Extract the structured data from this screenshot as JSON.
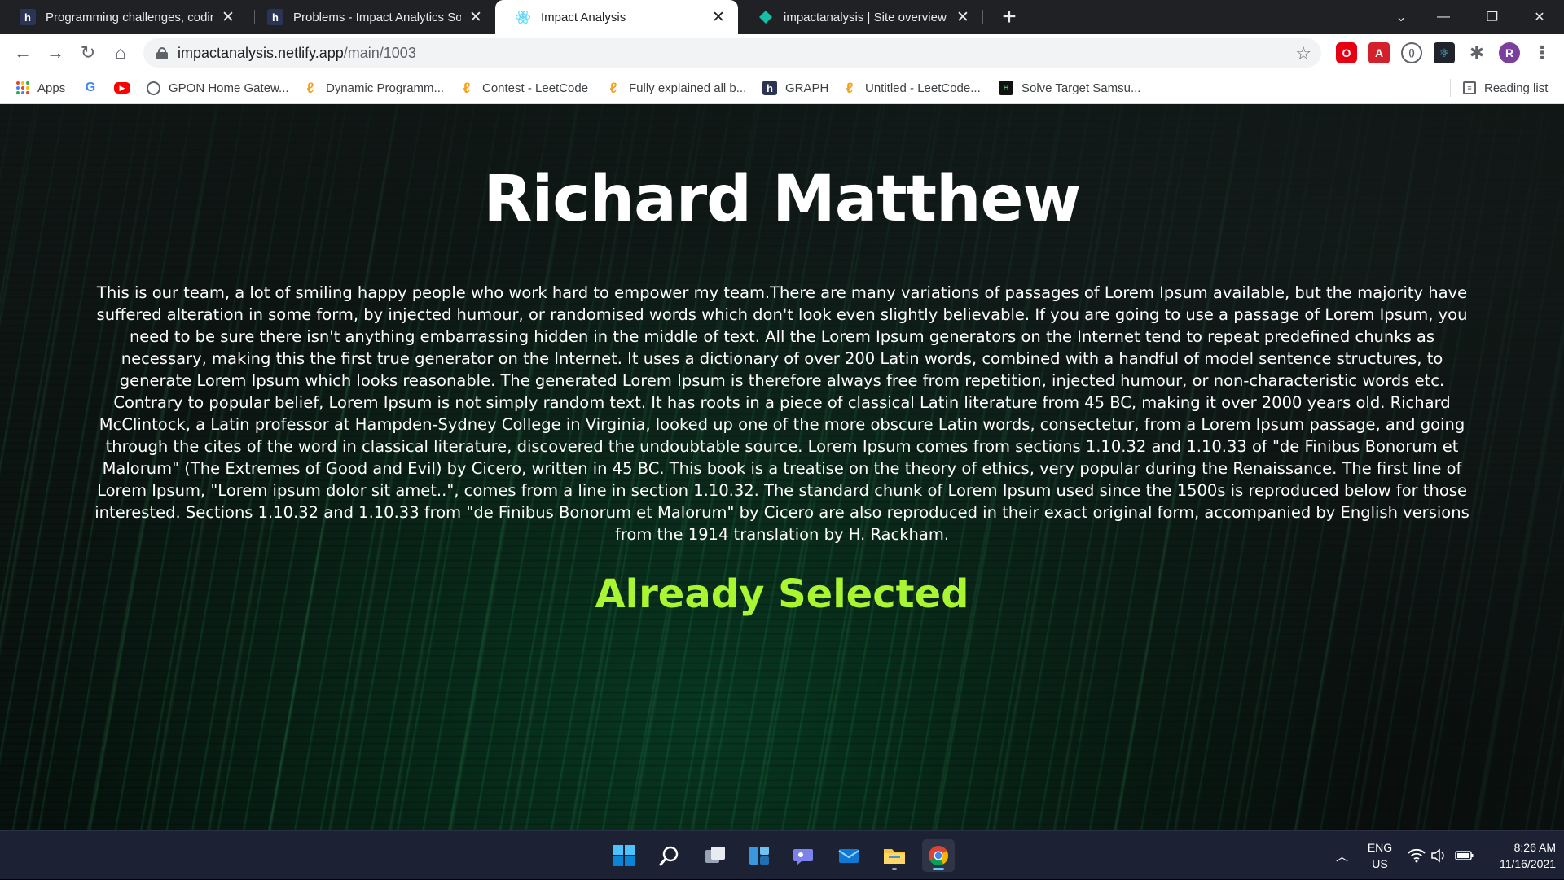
{
  "browser": {
    "tabs": [
      {
        "title": "Programming challenges, coding",
        "favicon": "hackerearth-icon",
        "active": false
      },
      {
        "title": "Problems - Impact Analytics Soft",
        "favicon": "hackerearth-icon",
        "active": false
      },
      {
        "title": "Impact Analysis",
        "favicon": "react-icon",
        "active": true
      },
      {
        "title": "impactanalysis | Site overview",
        "favicon": "netlify-icon",
        "active": false
      }
    ],
    "url_host": "impactanalysis.netlify.app",
    "url_path": "/main/1003",
    "bookmarks": [
      {
        "label": "Apps",
        "icon": "apps-grid-icon"
      },
      {
        "label": "",
        "icon": "google-icon"
      },
      {
        "label": "",
        "icon": "youtube-icon"
      },
      {
        "label": "GPON Home Gatew...",
        "icon": "globe-icon"
      },
      {
        "label": "Dynamic Programm...",
        "icon": "leetcode-icon"
      },
      {
        "label": "Contest - LeetCode",
        "icon": "leetcode-icon"
      },
      {
        "label": "Fully explained all b...",
        "icon": "leetcode-icon"
      },
      {
        "label": "GRAPH",
        "icon": "hackerearth-icon"
      },
      {
        "label": "Untitled - LeetCode...",
        "icon": "leetcode-icon"
      },
      {
        "label": "Solve Target Samsu...",
        "icon": "hackerearth-icon"
      }
    ],
    "reading_list_label": "Reading list"
  },
  "page": {
    "name": "Richard Matthew",
    "bio": "This is our team, a lot of smiling happy people who work hard to empower my team.There are many variations of passages of Lorem Ipsum available, but the majority have suffered alteration in some form, by injected humour, or randomised words which don't look even slightly believable. If you are going to use a passage of Lorem Ipsum, you need to be sure there isn't anything embarrassing hidden in the middle of text. All the Lorem Ipsum generators on the Internet tend to repeat predefined chunks as necessary, making this the first true generator on the Internet. It uses a dictionary of over 200 Latin words, combined with a handful of model sentence structures, to generate Lorem Ipsum which looks reasonable. The generated Lorem Ipsum is therefore always free from repetition, injected humour, or non-characteristic words etc. Contrary to popular belief, Lorem Ipsum is not simply random text. It has roots in a piece of classical Latin literature from 45 BC, making it over 2000 years old. Richard McClintock, a Latin professor at Hampden-Sydney College in Virginia, looked up one of the more obscure Latin words, consectetur, from a Lorem Ipsum passage, and going through the cites of the word in classical literature, discovered the undoubtable source. Lorem Ipsum comes from sections 1.10.32 and 1.10.33 of \"de Finibus Bonorum et Malorum\" (The Extremes of Good and Evil) by Cicero, written in 45 BC. This book is a treatise on the theory of ethics, very popular during the Renaissance. The first line of Lorem Ipsum, \"Lorem ipsum dolor sit amet..\", comes from a line in section 1.10.32. The standard chunk of Lorem Ipsum used since the 1500s is reproduced below for those interested. Sections 1.10.32 and 1.10.33 from \"de Finibus Bonorum et Malorum\" by Cicero are also reproduced in their exact original form, accompanied by English versions from the 1914 translation by H. Rackham.",
    "status": "Already Selected",
    "status_color": "#aaf531"
  },
  "taskbar": {
    "apps": [
      "windows-start-icon",
      "search-icon",
      "task-view-icon",
      "widgets-icon",
      "teams-chat-icon",
      "mail-icon",
      "file-explorer-icon",
      "chrome-icon"
    ],
    "lang_line1": "ENG",
    "lang_line2": "US",
    "time": "8:26 AM",
    "date": "11/16/2021"
  }
}
